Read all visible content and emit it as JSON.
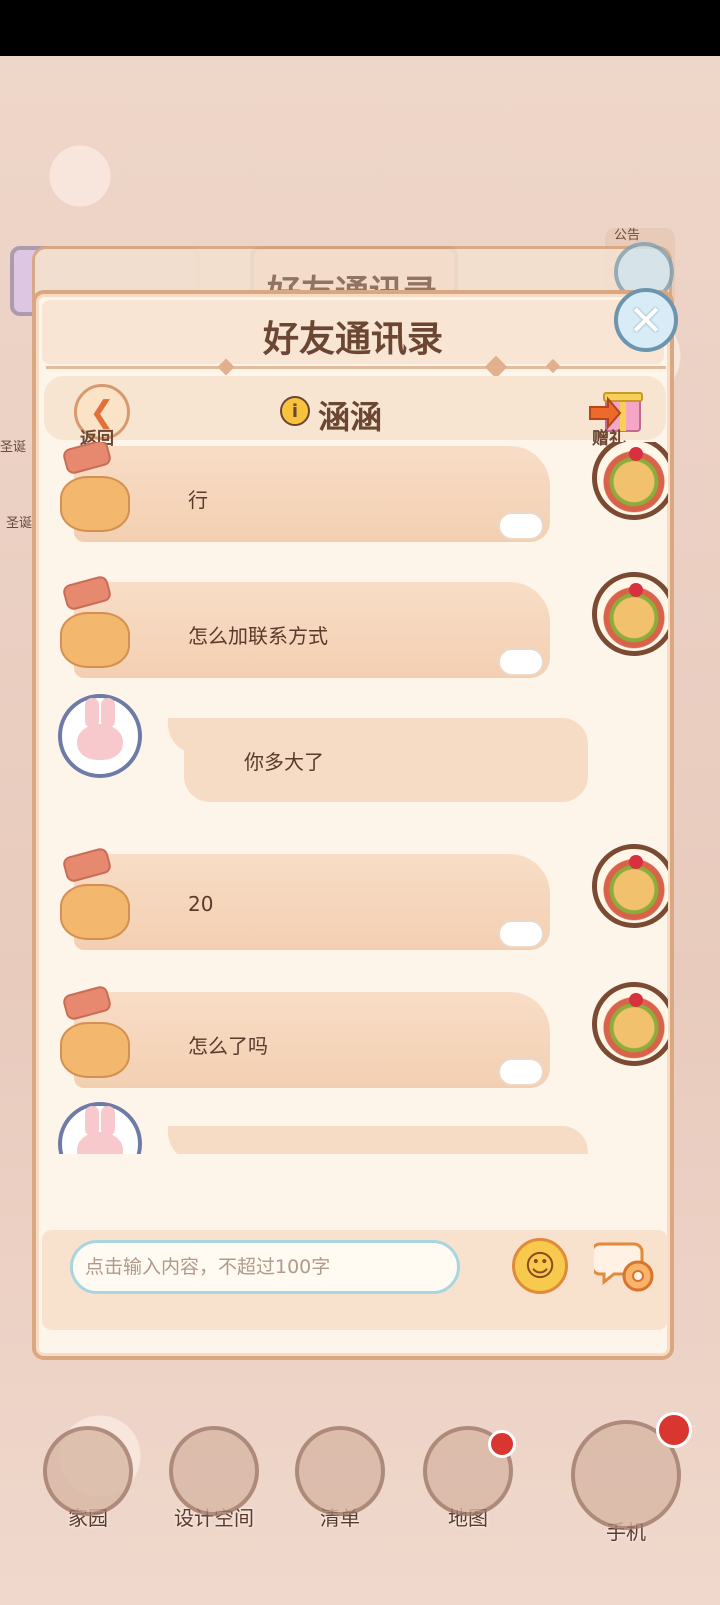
{
  "background": {
    "behind_title": "好友通讯录",
    "side_label_top": "公告",
    "side_labels": [
      "圣诞",
      "圣诞"
    ]
  },
  "panel": {
    "title": "好友通讯录",
    "back_label": "返回",
    "friend_name": "涵涵",
    "gift_label": "赠礼"
  },
  "messages": [
    {
      "sender": "friend",
      "text": "行"
    },
    {
      "sender": "friend",
      "text": "怎么加联系方式"
    },
    {
      "sender": "me",
      "text": "你多大了"
    },
    {
      "sender": "friend",
      "text": "20"
    },
    {
      "sender": "friend",
      "text": "怎么了吗"
    },
    {
      "sender": "me",
      "text": ""
    }
  ],
  "input": {
    "placeholder": "点击输入内容，不超过100字",
    "value": ""
  },
  "bottom_nav": [
    {
      "label": "家园",
      "icon": "home-icon"
    },
    {
      "label": "设计空间",
      "icon": "design-icon"
    },
    {
      "label": "清单",
      "icon": "list-icon"
    },
    {
      "label": "地图",
      "icon": "map-pin-icon"
    },
    {
      "label": "手机",
      "icon": "phone-icon"
    }
  ],
  "colors": {
    "panel_bg": "#fdf4ea",
    "panel_border": "#dba781",
    "title_text": "#6b4632",
    "bubble_friend": "#f3cfb2",
    "bubble_me": "#f6dcc4",
    "input_border": "#a7d6e1",
    "notification": "#d9362f"
  }
}
